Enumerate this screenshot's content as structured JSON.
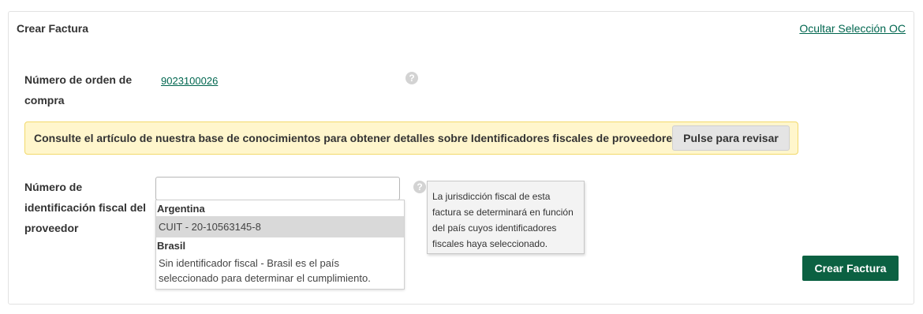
{
  "panel": {
    "title": "Crear Factura",
    "hide_selection_link": "Ocultar Selección OC"
  },
  "purchase_order": {
    "label": "Número de orden de compra",
    "value": "9023100026"
  },
  "notice": {
    "text": "Consulte el artículo de nuestra base de conocimientos para obtener detalles sobre Identificadores fiscales de proveedores",
    "button_label": "Pulse para revisar"
  },
  "tax_id": {
    "label": "Número de identificación fiscal del proveedor",
    "input_value": "",
    "dropdown": {
      "groups": [
        {
          "name": "Argentina",
          "options": [
            "CUIT - 20-10563145-8"
          ]
        },
        {
          "name": "Brasil",
          "options": [
            "Sin identificador fiscal - Brasil es el país seleccionado para determinar el cumplimiento."
          ]
        }
      ],
      "highlighted_option": "CUIT - 20-10563145-8"
    },
    "tooltip": "La jurisdicción fiscal de esta factura se determinará en función del país cuyos identificadores fiscales haya seleccionado."
  },
  "help_icon_glyph": "?",
  "actions": {
    "create_invoice_label": "Crear Factura"
  },
  "colors": {
    "link": "#00664f",
    "primary_button": "#0b6142",
    "notice_background": "#fff6cc",
    "notice_border": "#f2d96b",
    "highlight_row": "#d9d9d9"
  },
  "icons": {
    "help": "help-icon"
  }
}
